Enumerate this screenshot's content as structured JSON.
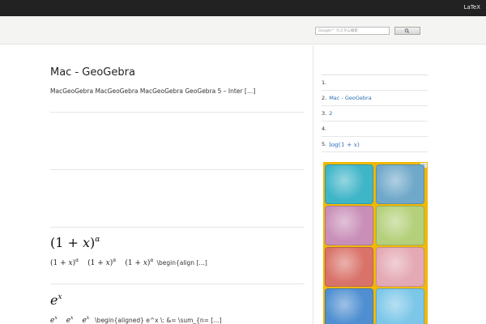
{
  "topbar": {
    "link_label": "LaTeX"
  },
  "search": {
    "placeholder": "Google™ カスタム検索"
  },
  "post": {
    "title": "Mac - GeoGebra",
    "excerpt": "MacGeoGebra MacGeoGebra MacGeoGebra GeoGebra 5 – Inter […]"
  },
  "entries": [
    {
      "title_base": "(1 + ",
      "title_var": "x",
      "title_close": ")",
      "title_sup": "α",
      "expr_base": "(1 + ",
      "expr_var": "x",
      "expr_close": ")",
      "expr_sup": "α",
      "tail": "\\begin{align […]"
    },
    {
      "title_var": "e",
      "title_sup": "x",
      "expr_var": "e",
      "expr_sup": "x",
      "tail": "\\begin{aligned} e^x \\: &= \\sum_{n= […]"
    }
  ],
  "sidebar": {
    "items": [
      {
        "number": "1.",
        "label": ""
      },
      {
        "number": "2.",
        "label": "Mac - GeoGebra"
      },
      {
        "number": "3.",
        "label": "2"
      },
      {
        "number": "4.",
        "label": ""
      },
      {
        "number": "5.",
        "label_prefix": "log(1 + ",
        "label_var": "x",
        "label_suffix": ")"
      }
    ]
  },
  "ad": {
    "badge": "D",
    "tiles": [
      {
        "name": "surgery-game",
        "color": "#3fb5c8"
      },
      {
        "name": "talking-cat-game",
        "color": "#6fa8c9"
      },
      {
        "name": "princess-game",
        "color": "#c98fb8"
      },
      {
        "name": "santa-doctor-game",
        "color": "#b4d07a"
      },
      {
        "name": "stomach-surgery-game",
        "color": "#d9736a"
      },
      {
        "name": "dentist-game",
        "color": "#e4a9b4"
      },
      {
        "name": "foot-doctor-game",
        "color": "#4f8fd1"
      },
      {
        "name": "ear-doctor-game",
        "color": "#7cc7e8"
      }
    ]
  }
}
